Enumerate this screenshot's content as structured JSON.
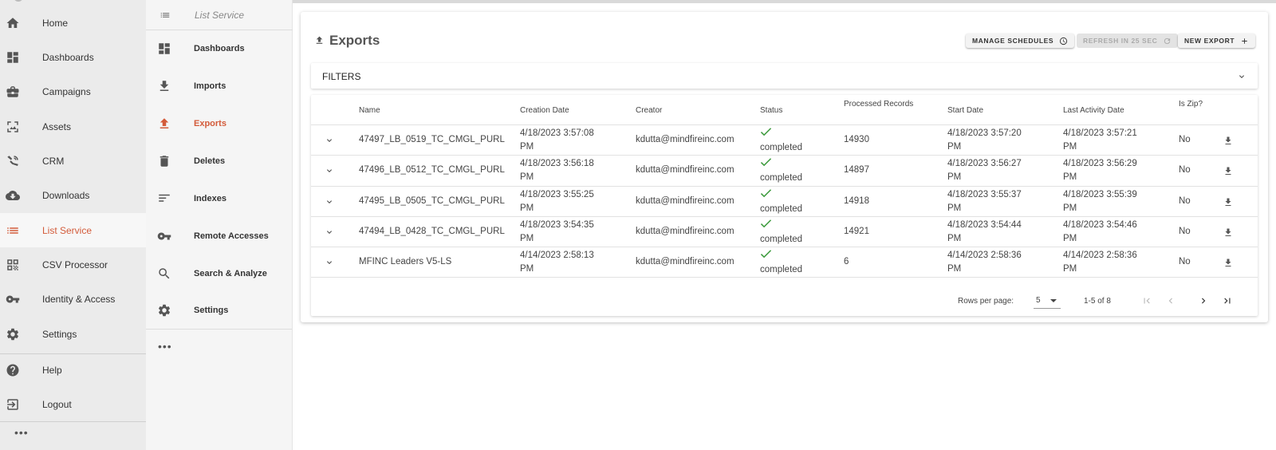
{
  "nav": {
    "items": [
      {
        "label": "Home",
        "icon": "home-icon"
      },
      {
        "label": "Dashboards",
        "icon": "dashboard-icon"
      },
      {
        "label": "Campaigns",
        "icon": "briefcase-icon"
      },
      {
        "label": "Assets",
        "icon": "image-icon"
      },
      {
        "label": "CRM",
        "icon": "crm-icon"
      },
      {
        "label": "Downloads",
        "icon": "cloud-download-icon"
      },
      {
        "label": "List Service",
        "icon": "list-icon",
        "active": true
      },
      {
        "label": "CSV Processor",
        "icon": "qr-icon"
      },
      {
        "label": "Identity & Access",
        "icon": "key-icon"
      },
      {
        "label": "Settings",
        "icon": "gear-icon"
      },
      {
        "label": "Help",
        "icon": "help-icon"
      },
      {
        "label": "Logout",
        "icon": "logout-icon"
      }
    ],
    "more": "•••"
  },
  "subnav": {
    "title": "List Service",
    "items": [
      {
        "label": "Dashboards",
        "icon": "dashboard-icon"
      },
      {
        "label": "Imports",
        "icon": "import-icon"
      },
      {
        "label": "Exports",
        "icon": "export-icon",
        "active": true
      },
      {
        "label": "Deletes",
        "icon": "trash-icon"
      },
      {
        "label": "Indexes",
        "icon": "index-icon"
      },
      {
        "label": "Remote Accesses",
        "icon": "key-icon"
      },
      {
        "label": "Search & Analyze",
        "icon": "search-icon"
      },
      {
        "label": "Settings",
        "icon": "gear-icon"
      }
    ],
    "more": "•••"
  },
  "main": {
    "title": "Exports",
    "buttons": {
      "manage_schedules": "MANAGE SCHEDULES",
      "refresh": "REFRESH IN 25 SEC",
      "new_export": "NEW EXPORT"
    },
    "filters_label": "FILTERS",
    "columns": {
      "name": "Name",
      "creation_date": "Creation Date",
      "creator": "Creator",
      "status": "Status",
      "processed_records": "Processed Records",
      "start_date": "Start Date",
      "last_activity_date": "Last Activity Date",
      "is_zip": "Is Zip?"
    },
    "rows": [
      {
        "name": "47497_LB_0519_TC_CMGL_PURL",
        "creation_1": "4/18/2023 3:57:08",
        "creation_2": "PM",
        "creator": "kdutta@mindfireinc.com",
        "status": "completed",
        "processed": "14930",
        "start_1": "4/18/2023 3:57:20",
        "start_2": "PM",
        "last_1": "4/18/2023 3:57:21",
        "last_2": "PM",
        "zip": "No"
      },
      {
        "name": "47496_LB_0512_TC_CMGL_PURL",
        "creation_1": "4/18/2023 3:56:18",
        "creation_2": "PM",
        "creator": "kdutta@mindfireinc.com",
        "status": "completed",
        "processed": "14897",
        "start_1": "4/18/2023 3:56:27",
        "start_2": "PM",
        "last_1": "4/18/2023 3:56:29",
        "last_2": "PM",
        "zip": "No"
      },
      {
        "name": "47495_LB_0505_TC_CMGL_PURL",
        "creation_1": "4/18/2023 3:55:25",
        "creation_2": "PM",
        "creator": "kdutta@mindfireinc.com",
        "status": "completed",
        "processed": "14918",
        "start_1": "4/18/2023 3:55:37",
        "start_2": "PM",
        "last_1": "4/18/2023 3:55:39",
        "last_2": "PM",
        "zip": "No"
      },
      {
        "name": "47494_LB_0428_TC_CMGL_PURL",
        "creation_1": "4/18/2023 3:54:35",
        "creation_2": "PM",
        "creator": "kdutta@mindfireinc.com",
        "status": "completed",
        "processed": "14921",
        "start_1": "4/18/2023 3:54:44",
        "start_2": "PM",
        "last_1": "4/18/2023 3:54:46",
        "last_2": "PM",
        "zip": "No"
      },
      {
        "name": "MFINC Leaders V5-LS",
        "creation_1": "4/14/2023 2:58:13",
        "creation_2": "PM",
        "creator": "kdutta@mindfireinc.com",
        "status": "completed",
        "processed": "6",
        "start_1": "4/14/2023 2:58:36",
        "start_2": "PM",
        "last_1": "4/14/2023 2:58:36",
        "last_2": "PM",
        "zip": "No"
      }
    ],
    "pagination": {
      "rows_per_page_label": "Rows per page:",
      "rows_per_page_value": "5",
      "range": "1-5 of 8"
    }
  },
  "colors": {
    "accent": "#d35b3a",
    "status_ok": "#3b9a3b"
  }
}
